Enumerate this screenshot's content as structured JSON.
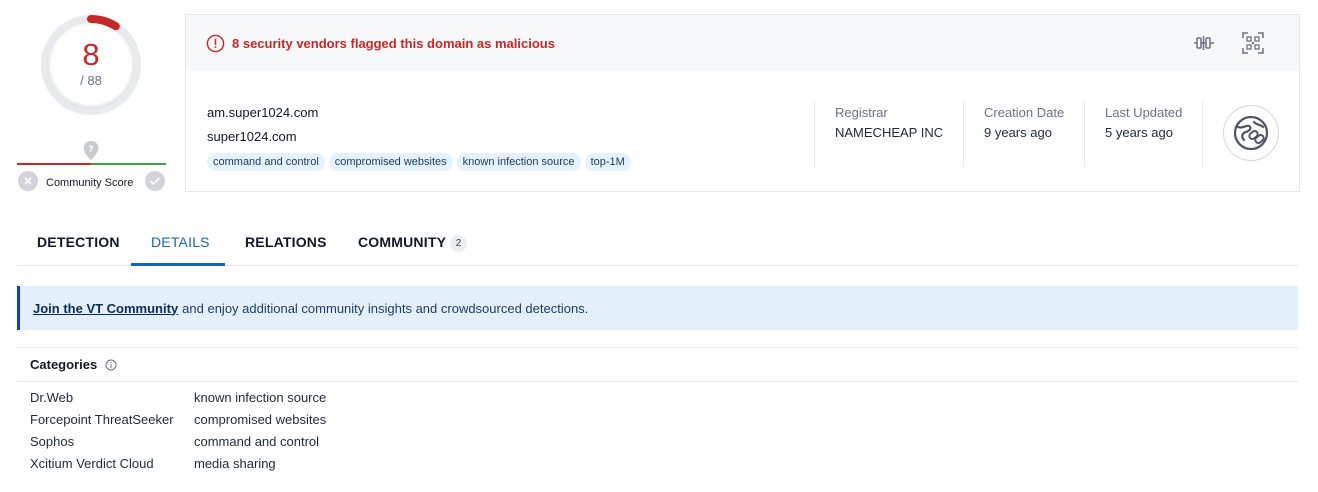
{
  "score": {
    "detected": "8",
    "total": "/ 88",
    "ratio": 0.0909,
    "color": "#c62828"
  },
  "community": {
    "label": "Community Score",
    "question_icon": "question-pin-icon",
    "minus_icon": "close-icon",
    "plus_icon": "check-icon"
  },
  "alert": {
    "icon": "alert-circle-icon",
    "text": "8 security vendors flagged this domain as malicious"
  },
  "header_actions": {
    "graph_icon": "graph-icon",
    "qr_icon": "qr-scan-icon"
  },
  "domain": {
    "name": "am.super1024.com",
    "parent": "super1024.com",
    "tags": [
      "command and control",
      "compromised websites",
      "known infection source",
      "top-1M"
    ]
  },
  "meta": {
    "registrar_label": "Registrar",
    "registrar_value": "NAMECHEAP INC",
    "creation_label": "Creation Date",
    "creation_value": "9 years ago",
    "updated_label": "Last Updated",
    "updated_value": "5 years ago",
    "favicon_icon": "web-link-icon"
  },
  "tabs": [
    {
      "label": "DETECTION"
    },
    {
      "label": "DETAILS",
      "active": true
    },
    {
      "label": "RELATIONS"
    },
    {
      "label": "COMMUNITY",
      "badge": "2"
    }
  ],
  "banner": {
    "link": "Join the VT Community",
    "text": "and enjoy additional community insights and crowdsourced detections."
  },
  "categories": {
    "title": "Categories",
    "rows": [
      {
        "vendor": "Dr.Web",
        "category": "known infection source"
      },
      {
        "vendor": "Forcepoint ThreatSeeker",
        "category": "compromised websites"
      },
      {
        "vendor": "Sophos",
        "category": "command and control"
      },
      {
        "vendor": "Xcitium Verdict Cloud",
        "category": "media sharing"
      }
    ]
  },
  "colors": {
    "malicious": "#c62828",
    "accent": "#1565c0",
    "tag_bg": "#e3f2fd",
    "banner_bg": "#e3f0fb"
  }
}
